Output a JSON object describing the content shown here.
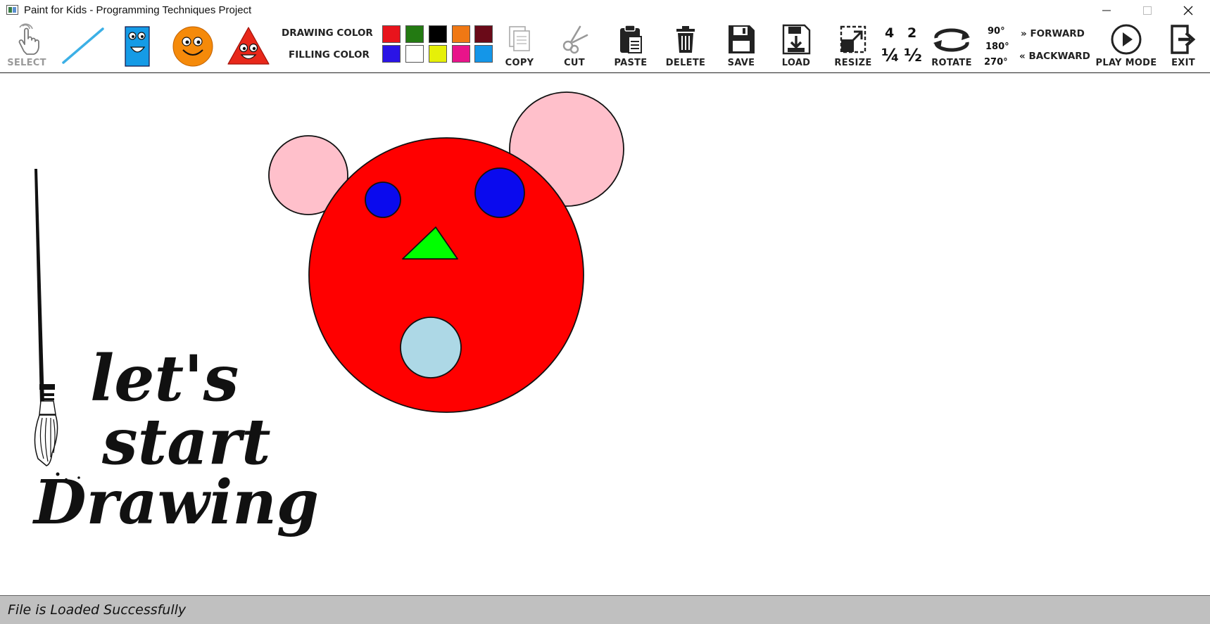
{
  "window": {
    "title": "Paint for Kids - Programming Techniques Project"
  },
  "toolbar": {
    "select_label": "SELECT",
    "drawing_color_label": "DRAWING COLOR",
    "filling_color_label": "FILLING COLOR",
    "drawing_colors": [
      "#e8141c",
      "#237a12",
      "#000000",
      "#f07814",
      "#6a0a18"
    ],
    "filling_colors": [
      "#2a14e6",
      "#ffffff",
      "#e6f008",
      "#e8148a",
      "#1496e8"
    ],
    "copy_label": "COPY",
    "cut_label": "CUT",
    "paste_label": "PASTE",
    "delete_label": "DELETE",
    "save_label": "SAVE",
    "load_label": "LOAD",
    "resize_label": "RESIZE",
    "resize_factors": [
      "4",
      "2",
      "¼",
      "½"
    ],
    "rotate_label": "ROTATE",
    "rotate_angles": [
      "90°",
      "180°",
      "270°"
    ],
    "forward_label": "FORWARD",
    "backward_label": "BACKWARD",
    "play_mode_label": "PLAY MODE",
    "exit_label": "EXIT"
  },
  "canvas": {
    "decoration_text": [
      "let's",
      "start",
      "Drawing"
    ],
    "shape_colors": {
      "face": "#ff0000",
      "ears": "#ffc0cb",
      "eyes": "#0a0aee",
      "nose": "#00ff00",
      "mouth": "#add8e6"
    }
  },
  "status": {
    "message": "File is Loaded Successfully"
  }
}
